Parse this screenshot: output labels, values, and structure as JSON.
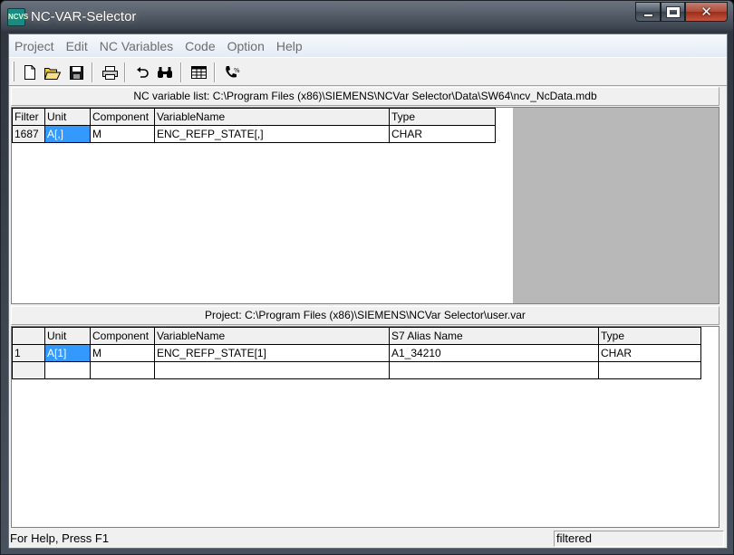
{
  "window": {
    "title": "NC-VAR-Selector",
    "icon_text": "NCVS"
  },
  "menu": [
    "Project",
    "Edit",
    "NC Variables",
    "Code",
    "Option",
    "Help"
  ],
  "toolbar": {
    "buttons": [
      "new-file-icon",
      "open-folder-icon",
      "save-icon",
      "print-icon",
      "undo-icon",
      "binoculars-find-icon",
      "table-icon",
      "phone-link-icon"
    ]
  },
  "nc_list": {
    "header": "NC variable list:  C:\\Program Files (x86)\\SIEMENS\\NCVar Selector\\Data\\SW64\\ncv_NcData.mdb",
    "columns": [
      "Filter",
      "Unit",
      "Component",
      "VariableName",
      "Type"
    ],
    "rows": [
      [
        "1687",
        "A[,]",
        "M",
        "ENC_REFP_STATE[,]",
        "CHAR"
      ]
    ]
  },
  "project": {
    "header": "Project:  C:\\Program Files (x86)\\SIEMENS\\NCVar Selector\\user.var",
    "columns": [
      "",
      "Unit",
      "Component",
      "VariableName",
      "S7 Alias Name",
      "Type"
    ],
    "rows": [
      [
        "1",
        "A[1]",
        "M",
        "ENC_REFP_STATE[1]",
        "A1_34210",
        "CHAR"
      ],
      [
        "",
        "",
        "",
        "",
        "",
        ""
      ]
    ]
  },
  "status": {
    "help": "For Help, Press F1",
    "mode": "filtered"
  },
  "colors": {
    "selection": "#3399ff",
    "panel": "#f0f0f0",
    "empty_grid": "#b8b8b8"
  }
}
